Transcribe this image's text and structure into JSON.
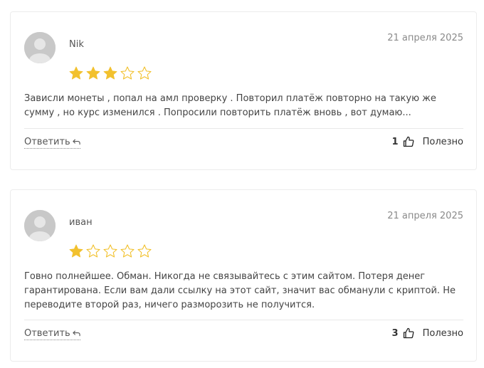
{
  "colors": {
    "star_filled": "#f2c12e",
    "star_empty_stroke": "#f2c12e",
    "avatar_bg": "#c8c8c8",
    "border": "#ececec"
  },
  "reviews": [
    {
      "author": "Nik",
      "date": "21 апреля 2025",
      "rating": 3,
      "rating_max": 5,
      "text": "Зависли монеты , попал на амл проверку . Повторил платёж повторно на такую же сумму , но курс изменился . Попросили повторить платёж вновь , вот думаю...",
      "reply_label": "Ответить",
      "reply_icon": "reply-arrow-icon",
      "helpful_count": "1",
      "helpful_icon": "thumbs-up-icon",
      "helpful_label": "Полезно"
    },
    {
      "author": "иван",
      "date": "21 апреля 2025",
      "rating": 1,
      "rating_max": 5,
      "text": "Говно полнейшее. Обман. Никогда не связывайтесь с этим сайтом. Потеря денег гарантирована. Если вам дали ссылку на этот сайт, значит вас обманули с криптой. Не переводите второй раз, ничего разморозить не получится.",
      "reply_label": "Ответить",
      "reply_icon": "reply-arrow-icon",
      "helpful_count": "3",
      "helpful_icon": "thumbs-up-icon",
      "helpful_label": "Полезно"
    }
  ]
}
